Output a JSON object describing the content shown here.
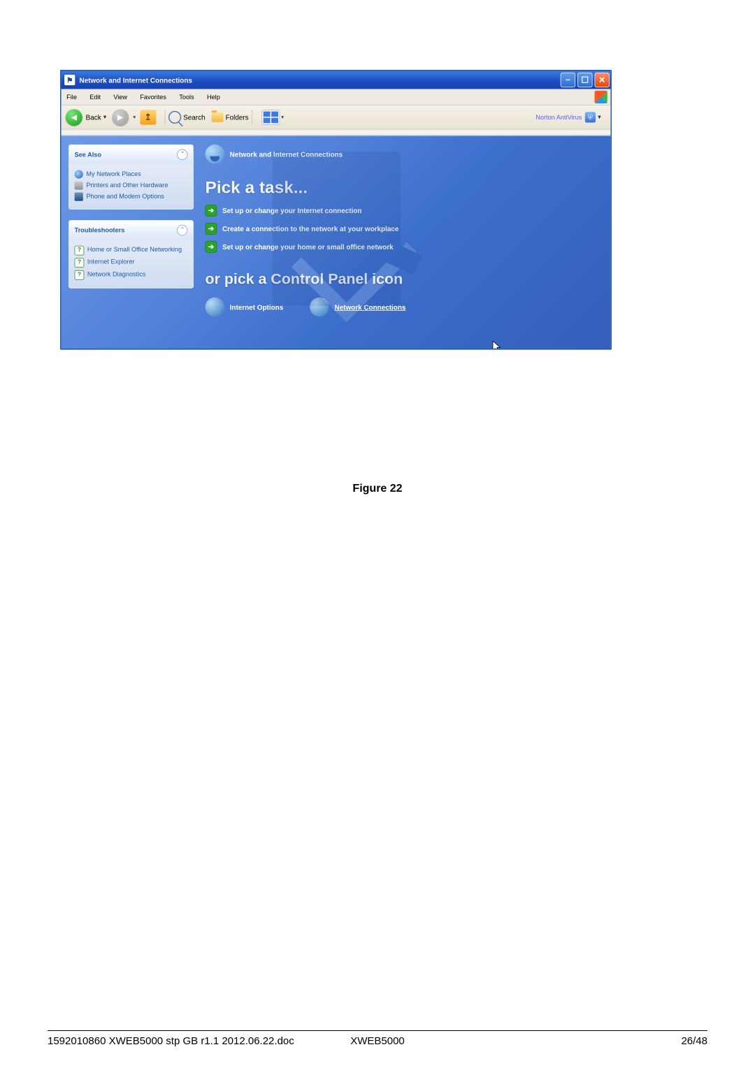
{
  "window": {
    "title": "Network and Internet Connections"
  },
  "menubar": {
    "items": [
      "File",
      "Edit",
      "View",
      "Favorites",
      "Tools",
      "Help"
    ]
  },
  "toolbar": {
    "back_label": "Back",
    "search_label": "Search",
    "folders_label": "Folders",
    "norton_label": "Norton AntiVirus"
  },
  "sidebar": {
    "see_also": {
      "header": "See Also",
      "items": [
        "My Network Places",
        "Printers and Other Hardware",
        "Phone and Modem Options"
      ]
    },
    "troubleshooters": {
      "header": "Troubleshooters",
      "items": [
        "Home or Small Office Networking",
        "Internet Explorer",
        "Network Diagnostics"
      ]
    }
  },
  "main": {
    "category_title": "Network and Internet Connections",
    "pick_a_task": "Pick a task...",
    "tasks": [
      "Set up or change your Internet connection",
      "Create a connection to the network at your workplace",
      "Set up or change your home or small office network"
    ],
    "or_pick": "or pick a Control Panel icon",
    "cp_icons": [
      "Internet Options",
      "Network Connections"
    ]
  },
  "caption": "Figure 22",
  "footer": {
    "left": "1592010860 XWEB5000 stp GB r1.1 2012.06.22.doc",
    "center": "XWEB5000",
    "right": "26/48"
  }
}
